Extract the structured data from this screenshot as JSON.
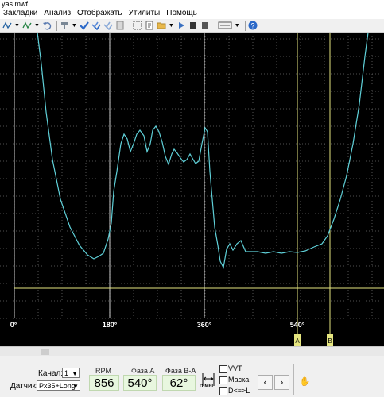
{
  "window": {
    "title": "yas.mwf"
  },
  "menu": [
    "Закладки",
    "Анализ",
    "Отображать",
    "Утилиты",
    "Помощь"
  ],
  "scope": {
    "x_ticks": [
      "0°",
      "180°",
      "360°",
      "540°"
    ],
    "markers": [
      "A",
      "B"
    ],
    "colors": {
      "background": "#000000",
      "trace": "#5fd0d8",
      "grid": "#ffffff",
      "marker": "#e6e680"
    }
  },
  "controls": {
    "channel_label": "Канал:",
    "channel_value": "1",
    "sensor_label": "Датчик:",
    "sensor_value": "Px35+Long",
    "rpm_label": "RPM",
    "rpm_value": "856",
    "phase_a_label": "Фаза A",
    "phase_a_value": "540°",
    "phase_ba_label": "Фаза B-A",
    "phase_ba_value": "62°",
    "icon_button_text": "D:MEL",
    "vvt_label": "VVT",
    "mask_label": "Маска",
    "dl_label": "D<=>L",
    "prev": "‹",
    "next": "›",
    "hand": "✋"
  }
}
